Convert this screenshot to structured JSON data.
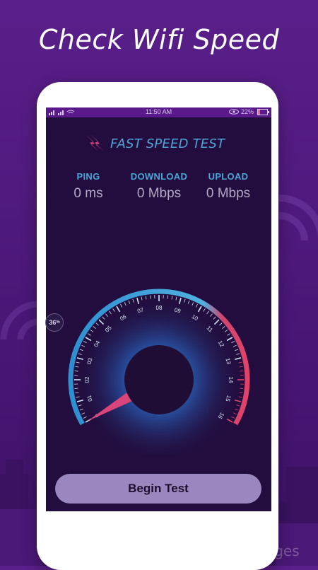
{
  "headline": "Check Wifi Speed",
  "status_bar": {
    "time": "11:50 AM",
    "battery": "22%",
    "battery_level": 0.22
  },
  "app": {
    "title": "FAST SPEED TEST",
    "metrics": [
      {
        "label": "PING",
        "value": "0 ms"
      },
      {
        "label": "DOWNLOAD",
        "value": "0 Mbps"
      },
      {
        "label": "UPLOAD",
        "value": "0 Mbps"
      }
    ],
    "gauge": {
      "ticks": [
        "0",
        "01",
        "02",
        "03",
        "04",
        "05",
        "06",
        "07",
        "08",
        "09",
        "10",
        "11",
        "12",
        "13",
        "14",
        "15",
        "16"
      ],
      "current_value": 0,
      "min": 0,
      "max": 16
    },
    "begin_button": "Begin Test"
  },
  "side_badge": "36",
  "watermark": "by Getty Images",
  "colors": {
    "accent_blue": "#4fa3d3",
    "accent_red": "#e0436a",
    "screen_bg": "#220d3e",
    "button_bg": "#9b87bf"
  }
}
